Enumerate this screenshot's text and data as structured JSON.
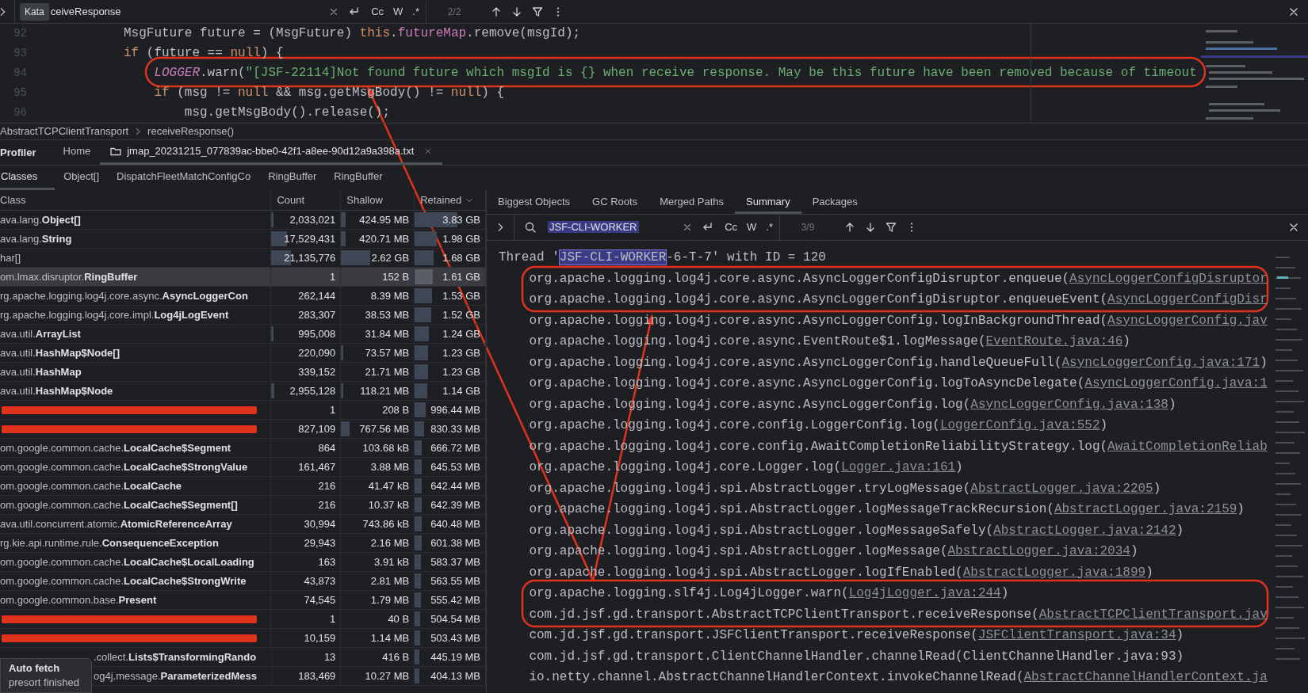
{
  "find_bar": {
    "tooltip": "Kata",
    "query": "ceiveResponse",
    "options": [
      "Cc",
      "W",
      ".*"
    ],
    "match_count": "2/2"
  },
  "editor": {
    "lines": [
      {
        "number": "92",
        "tokens": [
          {
            "kind": "plain",
            "text": "MsgFuture future = (MsgFuture) "
          },
          {
            "kind": "keyword",
            "text": "this"
          },
          {
            "kind": "plain",
            "text": "."
          },
          {
            "kind": "field",
            "text": "futureMap"
          },
          {
            "kind": "plain",
            "text": ".remove(msgId);"
          }
        ]
      },
      {
        "number": "93",
        "tokens": [
          {
            "kind": "keyword",
            "text": "if"
          },
          {
            "kind": "plain",
            "text": " (future == "
          },
          {
            "kind": "keyword",
            "text": "null"
          },
          {
            "kind": "plain",
            "text": ") {"
          }
        ],
        "children": [
          {
            "number": "94",
            "tokens": [
              {
                "kind": "static",
                "text": "LOGGER"
              },
              {
                "kind": "plain",
                "text": ".warn("
              },
              {
                "kind": "string",
                "text": "\"[JSF-22114]Not found future which msgId is {} when receive response. May be this future have been removed because of timeout"
              }
            ]
          },
          {
            "number": "95",
            "tokens": [
              {
                "kind": "keyword",
                "text": "if"
              },
              {
                "kind": "plain",
                "text": " (msg != "
              },
              {
                "kind": "keyword",
                "text": "null"
              },
              {
                "kind": "plain",
                "text": " && msg.getMsgBody() != "
              },
              {
                "kind": "keyword",
                "text": "null"
              },
              {
                "kind": "plain",
                "text": ") {"
              }
            ],
            "children": [
              {
                "number": "96",
                "tokens": [
                  {
                    "kind": "plain",
                    "text": "msg.getMsgBody().release();"
                  }
                ]
              }
            ]
          }
        ]
      }
    ]
  },
  "breadcrumb": [
    "AbstractTCPClientTransport",
    "receiveResponse()"
  ],
  "tool_window": {
    "title": "Profiler",
    "tabs": [
      {
        "label": "Home",
        "kind": "plain",
        "selected": false
      },
      {
        "label": "jmap_20231215_077839ac-bbe0-42f1-a8ee-90d12a9a398a.txt",
        "kind": "file",
        "selected": true
      }
    ]
  },
  "view_tabs": [
    {
      "label": "Classes",
      "selected": true
    },
    {
      "label": "Object[]",
      "selected": false
    },
    {
      "label": "DispatchFleetMatchConfigCo",
      "selected": false
    },
    {
      "label": "RingBuffer",
      "selected": false
    },
    {
      "label": "RingBuffer",
      "selected": false
    }
  ],
  "class_table": {
    "columns": [
      {
        "label": "Class",
        "sorted": false
      },
      {
        "label": "Count",
        "sorted": false
      },
      {
        "label": "Shallow",
        "sorted": false
      },
      {
        "label": "Retained",
        "sorted": true
      }
    ],
    "rows": [
      {
        "class": "ava.lang.**Object[]**",
        "count": "2,033,021",
        "shallow": "424.95 MB",
        "retained": "3.83 GB",
        "selected": false,
        "redacted": false,
        "covered": false
      },
      {
        "class": "ava.lang.**String**",
        "count": "17,529,431",
        "shallow": "420.71 MB",
        "retained": "1.98 GB",
        "selected": false,
        "redacted": false,
        "covered": false
      },
      {
        "class": "har[]",
        "count": "21,135,776",
        "shallow": "2.62 GB",
        "retained": "1.68 GB",
        "selected": false,
        "redacted": false,
        "covered": false
      },
      {
        "class": "om.lmax.disruptor.**RingBuffer**",
        "count": "1",
        "shallow": "152 B",
        "retained": "1.61 GB",
        "selected": true,
        "redacted": false,
        "covered": false
      },
      {
        "class": "rg.apache.logging.log4j.core.async.**AsyncLoggerCon**",
        "count": "262,144",
        "shallow": "8.39 MB",
        "retained": "1.53 GB",
        "selected": false,
        "redacted": false,
        "covered": false
      },
      {
        "class": "rg.apache.logging.log4j.core.impl.**Log4jLogEvent**",
        "count": "283,307",
        "shallow": "38.53 MB",
        "retained": "1.52 GB",
        "selected": false,
        "redacted": false,
        "covered": false
      },
      {
        "class": "ava.util.**ArrayList**",
        "count": "995,008",
        "shallow": "31.84 MB",
        "retained": "1.24 GB",
        "selected": false,
        "redacted": false,
        "covered": false
      },
      {
        "class": "ava.util.**HashMap$Node[]**",
        "count": "220,090",
        "shallow": "73.57 MB",
        "retained": "1.23 GB",
        "selected": false,
        "redacted": false,
        "covered": false
      },
      {
        "class": "ava.util.**HashMap**",
        "count": "339,152",
        "shallow": "21.71 MB",
        "retained": "1.23 GB",
        "selected": false,
        "redacted": false,
        "covered": false
      },
      {
        "class": "ava.util.**HashMap$Node**",
        "count": "2,955,128",
        "shallow": "118.21 MB",
        "retained": "1.14 GB",
        "selected": false,
        "redacted": false,
        "covered": false
      },
      {
        "count": "1",
        "shallow": "208 B",
        "retained": "996.44 MB",
        "selected": false,
        "redacted": true,
        "covered": false
      },
      {
        "count": "827,109",
        "shallow": "767.56 MB",
        "retained": "830.33 MB",
        "selected": false,
        "redacted": true,
        "covered": false
      },
      {
        "class": "om.google.common.cache.**LocalCache$Segment**",
        "count": "864",
        "shallow": "103.68 kB",
        "retained": "666.72 MB",
        "selected": false,
        "redacted": false,
        "covered": false
      },
      {
        "class": "om.google.common.cache.**LocalCache$StrongValue**",
        "count": "161,467",
        "shallow": "3.88 MB",
        "retained": "645.53 MB",
        "selected": false,
        "redacted": false,
        "covered": false
      },
      {
        "class": "om.google.common.cache.**LocalCache**",
        "count": "216",
        "shallow": "41.47 kB",
        "retained": "642.44 MB",
        "selected": false,
        "redacted": false,
        "covered": false
      },
      {
        "class": "om.google.common.cache.**LocalCache$Segment[]**",
        "count": "216",
        "shallow": "10.37 kB",
        "retained": "642.39 MB",
        "selected": false,
        "redacted": false,
        "covered": false
      },
      {
        "class": "ava.util.concurrent.atomic.**AtomicReferenceArray**",
        "count": "30,994",
        "shallow": "743.86 kB",
        "retained": "640.48 MB",
        "selected": false,
        "redacted": false,
        "covered": false
      },
      {
        "class": "rg.kie.api.runtime.rule.**ConsequenceException**",
        "count": "29,943",
        "shallow": "2.16 MB",
        "retained": "601.38 MB",
        "selected": false,
        "redacted": false,
        "covered": false
      },
      {
        "class": "om.google.common.cache.**LocalCache$LocalLoading**",
        "count": "163",
        "shallow": "3.91 kB",
        "retained": "583.37 MB",
        "selected": false,
        "redacted": false,
        "covered": false
      },
      {
        "class": "om.google.common.cache.**LocalCache$StrongWrite**",
        "count": "43,873",
        "shallow": "2.81 MB",
        "retained": "563.55 MB",
        "selected": false,
        "redacted": false,
        "covered": false
      },
      {
        "class": "om.google.common.base.**Present**",
        "count": "74,545",
        "shallow": "1.79 MB",
        "retained": "555.42 MB",
        "selected": false,
        "redacted": false,
        "covered": false
      },
      {
        "count": "1",
        "shallow": "40 B",
        "retained": "504.54 MB",
        "selected": false,
        "redacted": true,
        "covered": false
      },
      {
        "count": "10,159",
        "shallow": "1.14 MB",
        "retained": "503.43 MB",
        "selected": false,
        "redacted": true,
        "covered": false
      },
      {
        "class": ".collect.**Lists$TransformingRando**",
        "count": "13",
        "shallow": "416 B",
        "retained": "445.19 MB",
        "selected": false,
        "redacted": false,
        "covered": true
      },
      {
        "class": "og4j.message.**ParameterizedMess**",
        "count": "183,469",
        "shallow": "10.27 MB",
        "retained": "404.13 MB",
        "selected": false,
        "redacted": false,
        "covered": true
      }
    ]
  },
  "detail_tabs": [
    {
      "label": "Biggest Objects",
      "selected": false
    },
    {
      "label": "GC Roots",
      "selected": false
    },
    {
      "label": "Merged Paths",
      "selected": false
    },
    {
      "label": "Summary",
      "selected": true
    },
    {
      "label": "Packages",
      "selected": false
    }
  ],
  "detail_find_bar": {
    "query": "JSF-CLI-WORKER",
    "options": [
      "Cc",
      "W",
      ".*"
    ],
    "match_count": "3/9"
  },
  "stack": {
    "header": {
      "before": "Thread '",
      "match": "JSF-CLI-WORKER",
      "after": "-6-T-7' with ID = 120"
    },
    "frames": [
      {
        "call": "org.apache.logging.log4j.core.async.AsyncLoggerConfigDisruptor.enqueue(",
        "source": "AsyncLoggerConfigDisruptor"
      },
      {
        "call": "org.apache.logging.log4j.core.async.AsyncLoggerConfigDisruptor.enqueueEvent(",
        "source": "AsyncLoggerConfigDisr"
      },
      {
        "call": "org.apache.logging.log4j.core.async.AsyncLoggerConfig.logInBackgroundThread(",
        "source": "AsyncLoggerConfig.jav"
      },
      {
        "call": "org.apache.logging.log4j.core.async.EventRoute$1.logMessage(",
        "source": "EventRoute.java:46",
        "end": ")"
      },
      {
        "call": "org.apache.logging.log4j.core.async.AsyncLoggerConfig.handleQueueFull(",
        "source": "AsyncLoggerConfig.java:171",
        "end": ")"
      },
      {
        "call": "org.apache.logging.log4j.core.async.AsyncLoggerConfig.logToAsyncDelegate(",
        "source": "AsyncLoggerConfig.java:1"
      },
      {
        "call": "org.apache.logging.log4j.core.async.AsyncLoggerConfig.log(",
        "source": "AsyncLoggerConfig.java:138",
        "end": ")"
      },
      {
        "call": "org.apache.logging.log4j.core.config.LoggerConfig.log(",
        "source": "LoggerConfig.java:552",
        "end": ")"
      },
      {
        "call": "org.apache.logging.log4j.core.config.AwaitCompletionReliabilityStrategy.log(",
        "source": "AwaitCompletionReliab"
      },
      {
        "call": "org.apache.logging.log4j.core.Logger.log(",
        "source": "Logger.java:161",
        "end": ")"
      },
      {
        "call": "org.apache.logging.log4j.spi.AbstractLogger.tryLogMessage(",
        "source": "AbstractLogger.java:2205",
        "end": ")"
      },
      {
        "call": "org.apache.logging.log4j.spi.AbstractLogger.logMessageTrackRecursion(",
        "source": "AbstractLogger.java:2159",
        "end": ")"
      },
      {
        "call": "org.apache.logging.log4j.spi.AbstractLogger.logMessageSafely(",
        "source": "AbstractLogger.java:2142",
        "end": ")"
      },
      {
        "call": "org.apache.logging.log4j.spi.AbstractLogger.logMessage(",
        "source": "AbstractLogger.java:2034",
        "end": ")"
      },
      {
        "call": "org.apache.logging.log4j.spi.AbstractLogger.logIfEnabled(",
        "source": "AbstractLogger.java:1899",
        "end": ")"
      },
      {
        "call": "org.apache.logging.slf4j.Log4jLogger.warn(",
        "source": "Log4jLogger.java:244",
        "end": ")"
      },
      {
        "call": "com.jd.jsf.gd.transport.AbstractTCPClientTransport.receiveResponse(",
        "source": "AbstractTCPClientTransport.jav"
      },
      {
        "call": "com.jd.jsf.gd.transport.JSFClientTransport.receiveResponse(",
        "source": "JSFClientTransport.java:34",
        "end": ")"
      },
      {
        "call": "com.jd.jsf.gd.transport.ClientChannelHandler.channelRead(ClientChannelHandler.java:93)"
      },
      {
        "call": "io.netty.channel.AbstractChannelHandlerContext.invokeChannelRead(",
        "source": "AbstractChannelHandlerContext.ja"
      }
    ]
  },
  "notification": {
    "title": "Auto fetch",
    "message": "presort finished"
  }
}
